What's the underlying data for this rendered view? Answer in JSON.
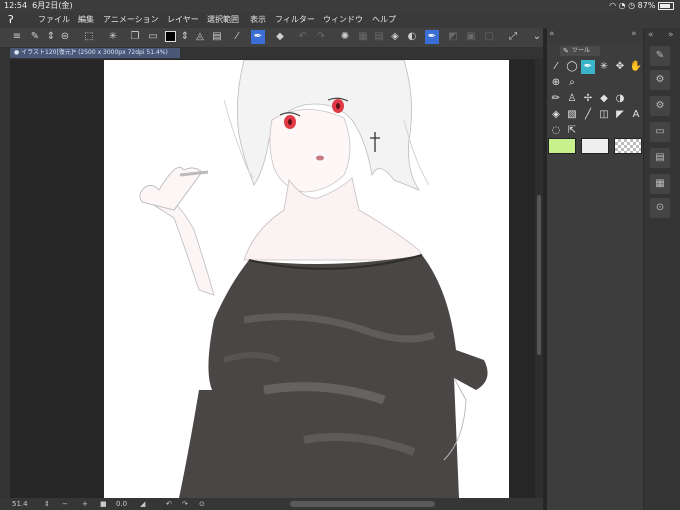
{
  "status": {
    "time": "12:54",
    "date": "6月2日(金)",
    "battery": "87%",
    "icons": [
      "wifi-icon",
      "orientation-lock-icon",
      "alarm-icon",
      "battery-icon"
    ]
  },
  "menu": [
    "ファイル",
    "編集",
    "アニメーション",
    "レイヤー",
    "選択範囲",
    "表示",
    "フィルター",
    "ウィンドウ",
    "ヘルプ"
  ],
  "toolbar": {
    "icons": [
      "menu-icon",
      "edit-layer-icon",
      "chevron-updown-icon",
      "history-icon",
      "selection-icon",
      "magic-wand-icon",
      "new-layer-icon",
      "folder-icon",
      "color-black-swatch",
      "chevron-updown-icon",
      "lasso-fill-icon",
      "eyedropper-icon",
      "pen-icon",
      "eraser-icon",
      "undo-icon",
      "redo-icon",
      "loading-icon",
      "layer-icon",
      "fill-icon",
      "blend-icon",
      "pen-active-icon",
      "ruler-icon",
      "crop-icon",
      "grid-icon",
      "checkmark-icon",
      "chevron-down-icon"
    ]
  },
  "document": {
    "tab_label": "● イラスト120[復元]* (2500 x 3000px 72dpi 51.4%)"
  },
  "bottom": {
    "zoom": "51.4",
    "rotation": "0.0",
    "minus": "−",
    "plus": "+"
  },
  "tool_panel": {
    "tab_label": "ツール",
    "tools": [
      "eyedropper-icon",
      "lasso-icon",
      "pen-icon",
      "magic-wand-icon",
      "move-icon",
      "hand-icon",
      "zoom-icon",
      "search-icon",
      "pencil-icon",
      "blend-icon",
      "brush-icon",
      "eraser-icon",
      "drop-icon",
      "fill-icon",
      "gradient-icon",
      "line-icon",
      "frame-icon",
      "ruler-icon",
      "text-icon",
      "balloon-icon",
      "correct-icon"
    ],
    "colors": [
      "#c8f08c",
      "#efefef",
      "transparent"
    ]
  },
  "side_icons": [
    "pen-icon",
    "brush-settings-icon",
    "sub-tool-icon",
    "layer-property-icon",
    "layers-icon",
    "navigator-icon",
    "search-icon"
  ]
}
